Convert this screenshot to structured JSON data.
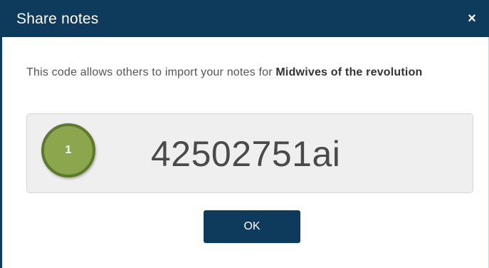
{
  "dialog": {
    "title": "Share notes",
    "close_glyph": "×",
    "message_prefix": "This code allows others to import your notes for ",
    "message_book": "Midwives of the revolution",
    "share_code": "42502751ai",
    "step_marker": "1",
    "ok_label": "OK"
  },
  "colors": {
    "titlebar": "#0e3a5c",
    "button": "#0e3a5c",
    "code_box": "#efefef",
    "marker_fill": "#8ca64e",
    "marker_border": "#5d7a2c"
  },
  "icons": {
    "close": "close-icon"
  }
}
